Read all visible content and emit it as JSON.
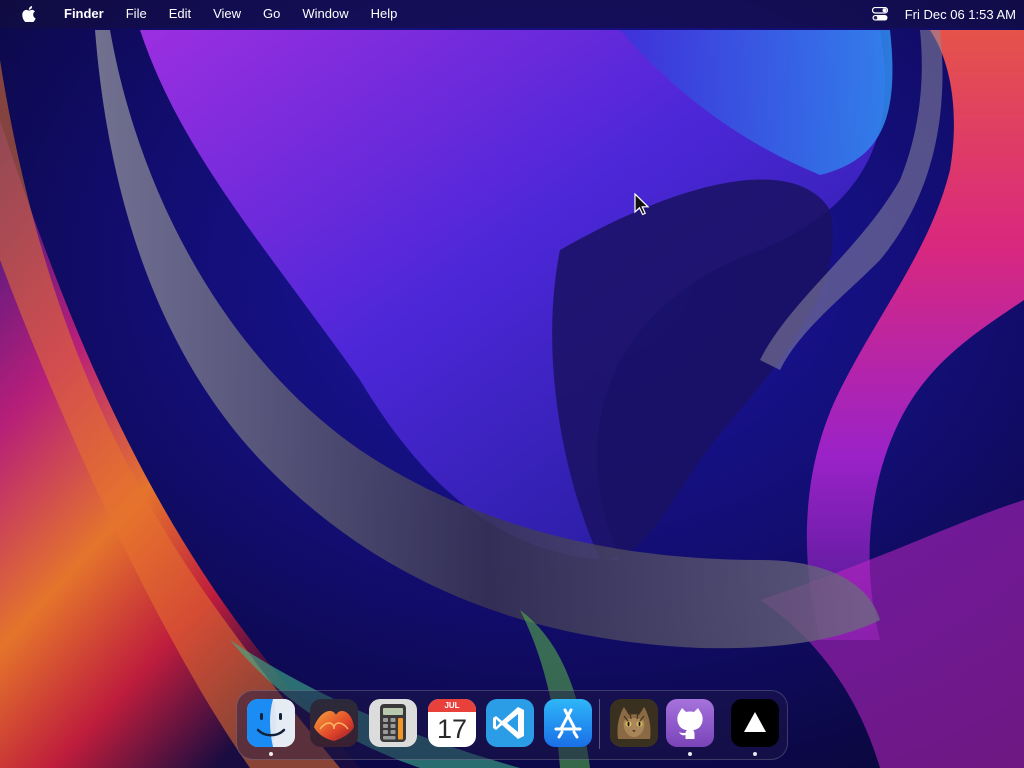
{
  "menubar": {
    "apple_menu": "apple-logo-icon",
    "app_name": "Finder",
    "menus": [
      "File",
      "Edit",
      "View",
      "Go",
      "Window",
      "Help"
    ],
    "status_icon": "control-center-icon",
    "clock": "Fri Dec 06  1:53 AM"
  },
  "dock": {
    "apps": [
      {
        "name": "Finder",
        "icon": "finder-icon",
        "running": true
      },
      {
        "name": "Launchpad",
        "icon": "launchpad-icon",
        "running": false
      },
      {
        "name": "Calculator",
        "icon": "calculator-icon",
        "running": false
      },
      {
        "name": "Calendar",
        "icon": "calendar-icon",
        "running": false,
        "month": "JUL",
        "day": "17"
      },
      {
        "name": "Visual Studio Code",
        "icon": "vscode-icon",
        "running": false
      },
      {
        "name": "App Store",
        "icon": "app-store-icon",
        "running": false
      },
      {
        "name": "Cat",
        "icon": "cat-photo-icon",
        "running": false
      },
      {
        "name": "GitHub",
        "icon": "github-icon",
        "running": true
      },
      {
        "name": "Vercel",
        "icon": "vercel-triangle-icon",
        "running": true
      }
    ]
  },
  "colors": {
    "accent_blue": "#1b8cf3",
    "vscode_blue": "#2b9de6",
    "calendar_red": "#e8413b",
    "github_purple": "#8f5ac8"
  }
}
